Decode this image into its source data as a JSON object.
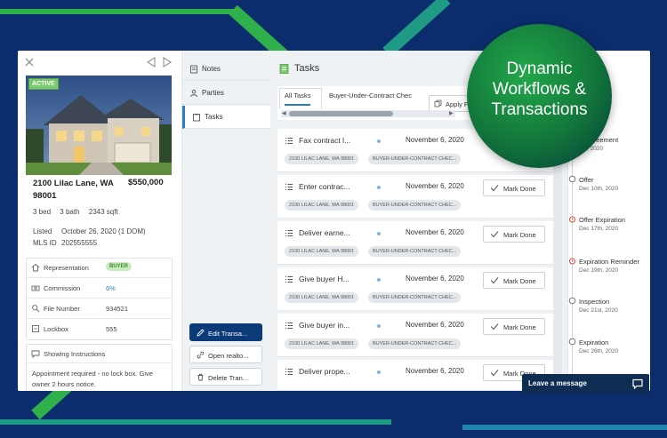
{
  "promo": {
    "line1": "Dynamic",
    "line2": "Workflows &",
    "line3": "Transactions"
  },
  "listing": {
    "status_badge": "ACTIVE",
    "address": "2100 Lilac Lane, WA 98001",
    "price": "$550,000",
    "beds": "3 bed",
    "baths": "3 bath",
    "sqft": "2343 sqft",
    "listed_label": "Listed",
    "listed_value": "October 26, 2020 (1 DOM)",
    "mls_label": "MLS ID",
    "mls_value": "202555555"
  },
  "info": {
    "representation_label": "Representation",
    "representation_value": "BUYER",
    "commission_label": "Commission",
    "commission_value": "6%",
    "file_label": "File Number",
    "file_value": "934521",
    "lockbox_label": "Lockbox",
    "lockbox_value": "555"
  },
  "instructions": {
    "title": "Showing Instructions",
    "body": "Appointment required - no lock box. Give owner 2 hours notice."
  },
  "sidenav": {
    "notes": "Notes",
    "parties": "Parties",
    "tasks": "Tasks"
  },
  "actions": {
    "edit": "Edit Transa...",
    "open": "Open realto...",
    "delete": "Delete Tran..."
  },
  "tasks": {
    "title": "Tasks",
    "tab_all": "All Tasks",
    "tab_buyer": "Buyer-Under-Contract Chec",
    "apply_label": "Apply F",
    "mark_done": "Mark Done",
    "tag_address": "2100 LILAC LANE, WA 98001",
    "tag_checklist": "BUYER-UNDER-CONTRACT CHEC...",
    "items": [
      {
        "name": "Fax contract l...",
        "date": "November 6, 2020"
      },
      {
        "name": "Enter contrac...",
        "date": "November 6, 2020"
      },
      {
        "name": "Deliver earne...",
        "date": "November 6, 2020"
      },
      {
        "name": "Give buyer H...",
        "date": "November 6, 2020"
      },
      {
        "name": "Give buyer in...",
        "date": "November 6, 2020"
      },
      {
        "name": "Deliver prope...",
        "date": "November 6, 2020"
      }
    ]
  },
  "timeline": {
    "top_date": "20",
    "items": [
      {
        "name": "ct Agreement",
        "date": "6th, 2020"
      },
      {
        "name": "Offer",
        "date": "Dec 10th, 2020"
      },
      {
        "name": "Offer Expiration",
        "date": "Dec 17th, 2020"
      },
      {
        "name": "Expiration Reminder",
        "date": "Dec 19th, 2020"
      },
      {
        "name": "Inspection",
        "date": "Dec 21st, 2020"
      },
      {
        "name": "Expiration",
        "date": "Dec 26th, 2020"
      }
    ]
  },
  "chat": {
    "label": "Leave a message"
  },
  "colors": {
    "background": "#0b2d6e",
    "accent_blue": "#2a7fc1",
    "primary_button": "#0b3a78",
    "active_green": "#7bc96f",
    "alarm_red": "#e0473b"
  }
}
